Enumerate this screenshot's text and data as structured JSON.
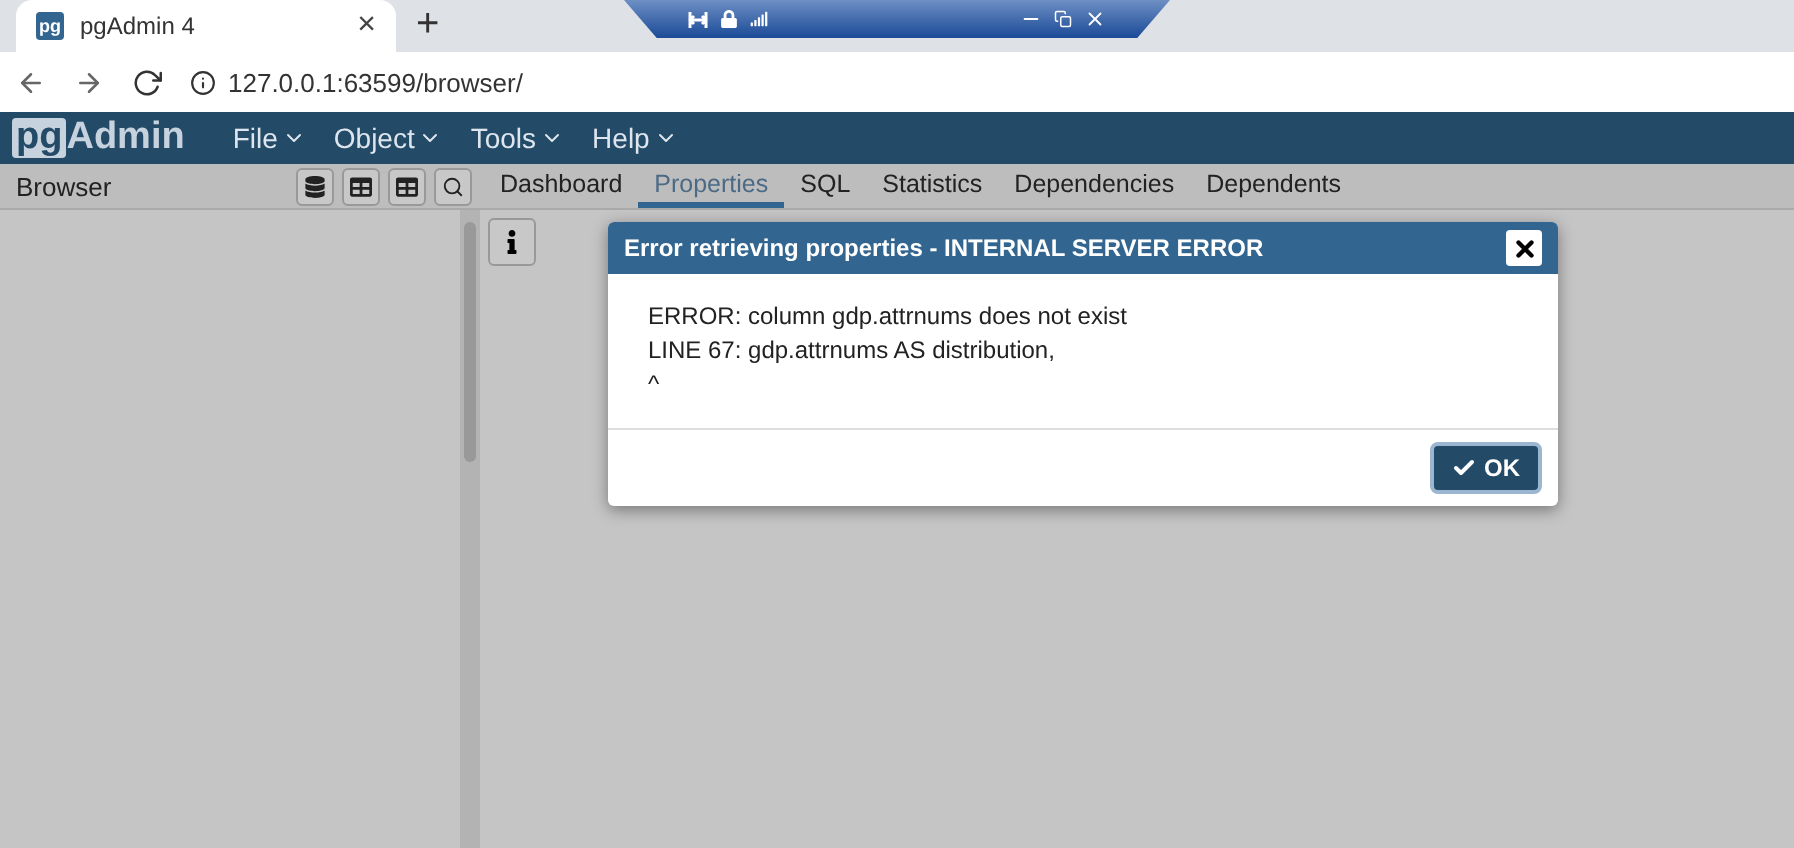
{
  "browser_tab": {
    "favicon": "pg",
    "title": "pgAdmin 4",
    "close": "×",
    "new_tab": "+"
  },
  "address_bar": {
    "url": "127.0.0.1:63599/browser/"
  },
  "app": {
    "logo_pg": "pg",
    "logo_text": "Admin",
    "menus": [
      {
        "label": "File"
      },
      {
        "label": "Object"
      },
      {
        "label": "Tools"
      },
      {
        "label": "Help"
      }
    ]
  },
  "browser_panel": {
    "title": "Browser"
  },
  "tabs": [
    {
      "label": "Dashboard",
      "selected": false
    },
    {
      "label": "Properties",
      "selected": true
    },
    {
      "label": "SQL",
      "selected": false
    },
    {
      "label": "Statistics",
      "selected": false
    },
    {
      "label": "Dependencies",
      "selected": false
    },
    {
      "label": "Dependents",
      "selected": false
    }
  ],
  "dialog": {
    "title": "Error retrieving properties - INTERNAL SERVER ERROR",
    "lines": [
      "ERROR: column gdp.attrnums does not exist",
      "LINE 67: gdp.attrnums AS distribution,",
      "^"
    ],
    "ok": "OK"
  }
}
